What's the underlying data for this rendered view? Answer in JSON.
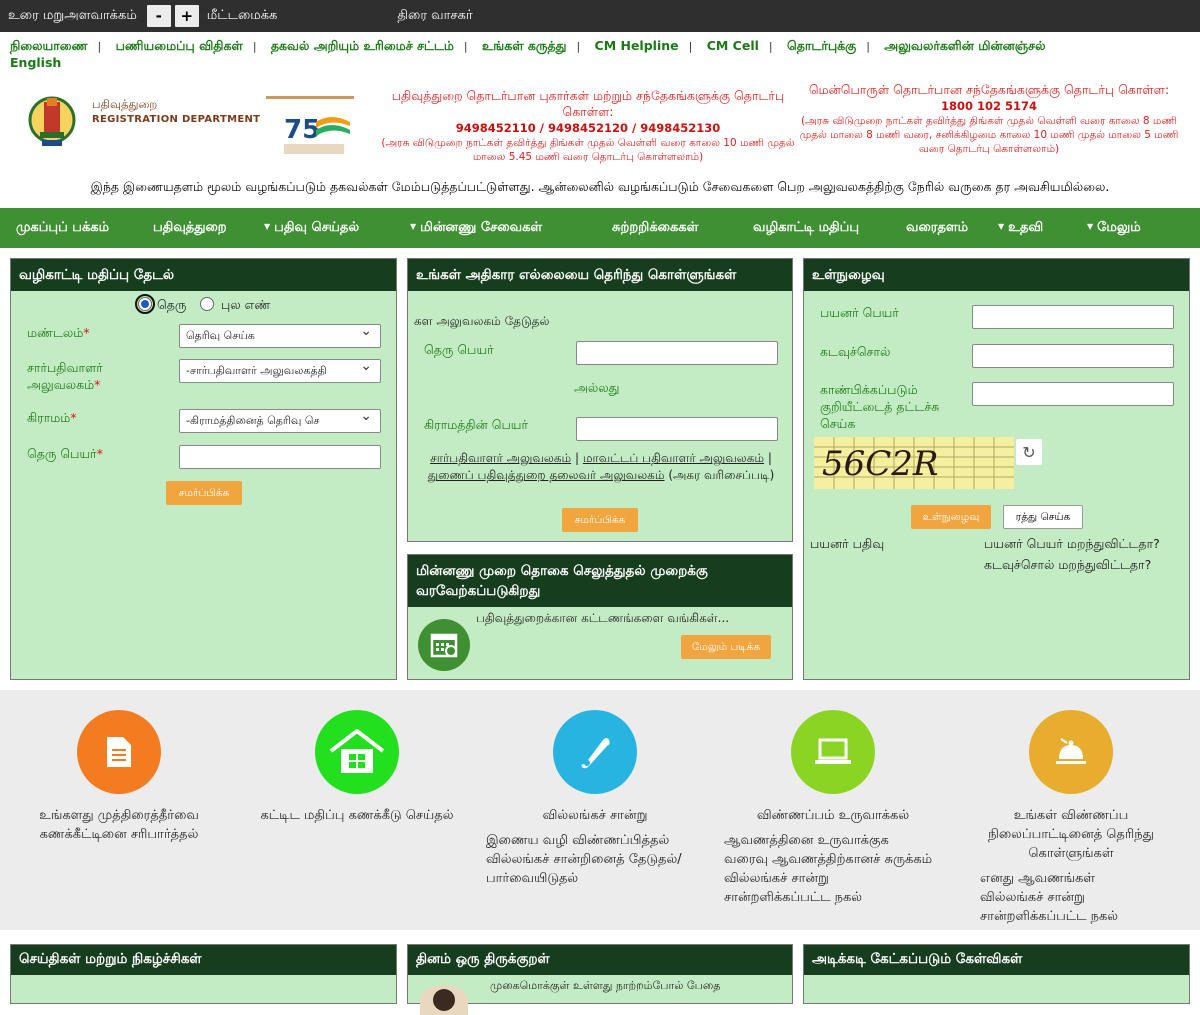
{
  "topbar": {
    "screen_reader_label": "உரை மறுஅளவாக்கம்",
    "minus": "-",
    "plus": "+",
    "reset": "மீட்டமைக்க",
    "reader": "திரை வாசகர்"
  },
  "toplinks": [
    "நிலையாணை",
    "பணியமைப்பு விதிகள்",
    "தகவல் அறியும் உரிமைச் சட்டம்",
    "உங்கள் கருத்து",
    "CM Helpline",
    "CM Cell",
    "தொடர்புக்கு",
    "அலுவலர்களின் மின்னஞ்சல்"
  ],
  "english": "English",
  "header": {
    "dept_tamil": "பதிவுத்துறை",
    "dept_english": "REGISTRATION DEPARTMENT",
    "contact1_title": "பதிவுத்துறை தொடர்பான புகார்கள் மற்றும் சந்தேகங்களுக்கு தொடர்பு கொள்ள:",
    "contact1_phones": "9498452110 / 9498452120 / 9498452130",
    "contact1_hours": "(அரசு விடுமுறை நாட்கள் தவிர்த்து திங்கள் முதல் வெள்ளி வரை காலை 10 மணி முதல் மாலை 5.45 மணி வரை தொடர்பு கொள்ளலாம்)",
    "contact2_title": "மென்பொருள் தொடர்பான சந்தேகங்களுக்கு தொடர்பு கொள்ள:",
    "contact2_phone": "1800 102 5174",
    "contact2_hours": "(அரசு விடுமுறை நாட்கள் தவிர்த்து திங்கள் முதல் வெள்ளி வரை காலை 8 மணி முதல் மாலை 8 மணி வரை, சனிக்கிழமை காலை 10 மணி முதல் மாலை 5 மணி வரை தொடர்பு கொள்ளலாம்)",
    "notice": "இந்த இணையதளம் மூலம் வழங்கப்படும் தகவல்கள் மேம்படுத்தப்பட்டுள்ளது. ஆன்லைனில் வழங்கப்படும் சேவைகளை பெற அலுவலகத்திற்கு நேரில் வருகை தர அவசியமில்லை."
  },
  "nav": [
    "முகப்புப் பக்கம்",
    "பதிவுத்துறை",
    "பதிவு செய்தல்",
    "மின்னணு சேவைகள்",
    "சுற்றறிக்கைகள்",
    "வழிகாட்டி மதிப்பு",
    "வரைதளம்",
    "உதவி",
    "மேலும்"
  ],
  "gv_search": {
    "title": "வழிகாட்டி மதிப்பு தேடல்",
    "radio_street": "தெரு",
    "radio_survey": "புல எண்",
    "zone_label": "மண்டலம்",
    "zone_value": "தெரிவு செய்க",
    "sro_label": "சார்பதிவாளர் அலுவலகம்",
    "sro_value": "-சார்பதிவாளர் அலுவலகத்தி",
    "village_label": "கிராமம்",
    "village_value": "-கிராமத்தினைத் தெரிவு செ",
    "street_label": "தெரு பெயர்",
    "submit": "சமர்ப்பிக்க"
  },
  "jurisdiction": {
    "title": "உங்கள் அதிகார எல்லையை தெரிந்து கொள்ளுங்கள்",
    "subtitle": "கள அலுவலகம் தேடுதல்",
    "street_label": "தெரு பெயர்",
    "or": "அல்லது",
    "village_label": "கிராமத்தின் பெயர்",
    "link1": "சார்பதிவாளர் அலுவலகம்",
    "link2": "மாவட்டப் பதிவாளர் அலுவலகம்",
    "link3": "துணைப் பதிவுத்துறை தலைவர் அலுவலகம்",
    "sort_note": "(அகர வரிசைப்படி)",
    "submit": "சமர்ப்பிக்க"
  },
  "epay": {
    "title": "மின்னணு முறை தொகை செலுத்துதல் முறைக்கு வரவேற்கப்படுகிறது",
    "text": "பதிவுத்துறைக்கான கட்டணங்களை வங்கிகள்...",
    "more": "மேலும் படிக்க"
  },
  "login": {
    "title": "உள்நுழைவு",
    "user_label": "பயனர் பெயர்",
    "pass_label": "கடவுச்சொல்",
    "captcha_label": "காண்பிக்கப்படும் குறியீட்டைத் தட்டச்சு செய்க",
    "captcha_text": "56C2R",
    "login_btn": "உள்நுழைவு",
    "cancel_btn": "ரத்து செய்க",
    "register": "பயனர் பதிவு",
    "forgot_user": "பயனர் பெயர் மறந்துவிட்டதா?",
    "forgot_pass": "கடவுச்சொல் மறந்துவிட்டதா?"
  },
  "services": [
    {
      "icon": "document-icon",
      "color": "#f37b20",
      "title": "உங்களது முத்திரைத்தீர்வை கணக்கீட்டினை சரிபார்த்தல்",
      "links": []
    },
    {
      "icon": "building-calc-icon",
      "color": "#22e01e",
      "title": "கட்டிட மதிப்பு கணக்கீடு செய்தல்",
      "links": []
    },
    {
      "icon": "scroll-icon",
      "color": "#28b4e0",
      "title": "வில்லங்கச் சான்று",
      "links": [
        "இணைய வழி விண்ணப்பித்தல்",
        "வில்லங்கச் சான்றினைத் தேடுதல்/பார்வையிடுதல்"
      ]
    },
    {
      "icon": "laptop-icon",
      "color": "#8ad424",
      "title": "விண்ணப்பம் உருவாக்கல்",
      "links": [
        "ஆவணத்தினை உருவாக்குக",
        "வரைவு ஆவணத்திற்கானச் சுருக்கம்",
        "வில்லங்கச் சான்று",
        "சான்றளிக்கப்பட்ட நகல்"
      ]
    },
    {
      "icon": "service-bell-icon",
      "color": "#e8ad2e",
      "title": "உங்கள் விண்ணப்ப நிலைப்பாட்டினைத் தெரிந்து கொள்ளுங்கள்",
      "links": [
        "எனது ஆவணங்கள்",
        "வில்லங்கச் சான்று",
        "சான்றளிக்கப்பட்ட நகல்"
      ]
    }
  ],
  "bottom": {
    "news": "செய்திகள் மற்றும் நிகழ்ச்சிகள்",
    "kural": "தினம் ஒரு திருக்குறள்",
    "kural_line": "முகைமொக்குள் உள்ளது நாற்றம்போல் பேதை",
    "faq": "அடிக்கடி கேட்கப்படும் கேள்விகள்"
  }
}
